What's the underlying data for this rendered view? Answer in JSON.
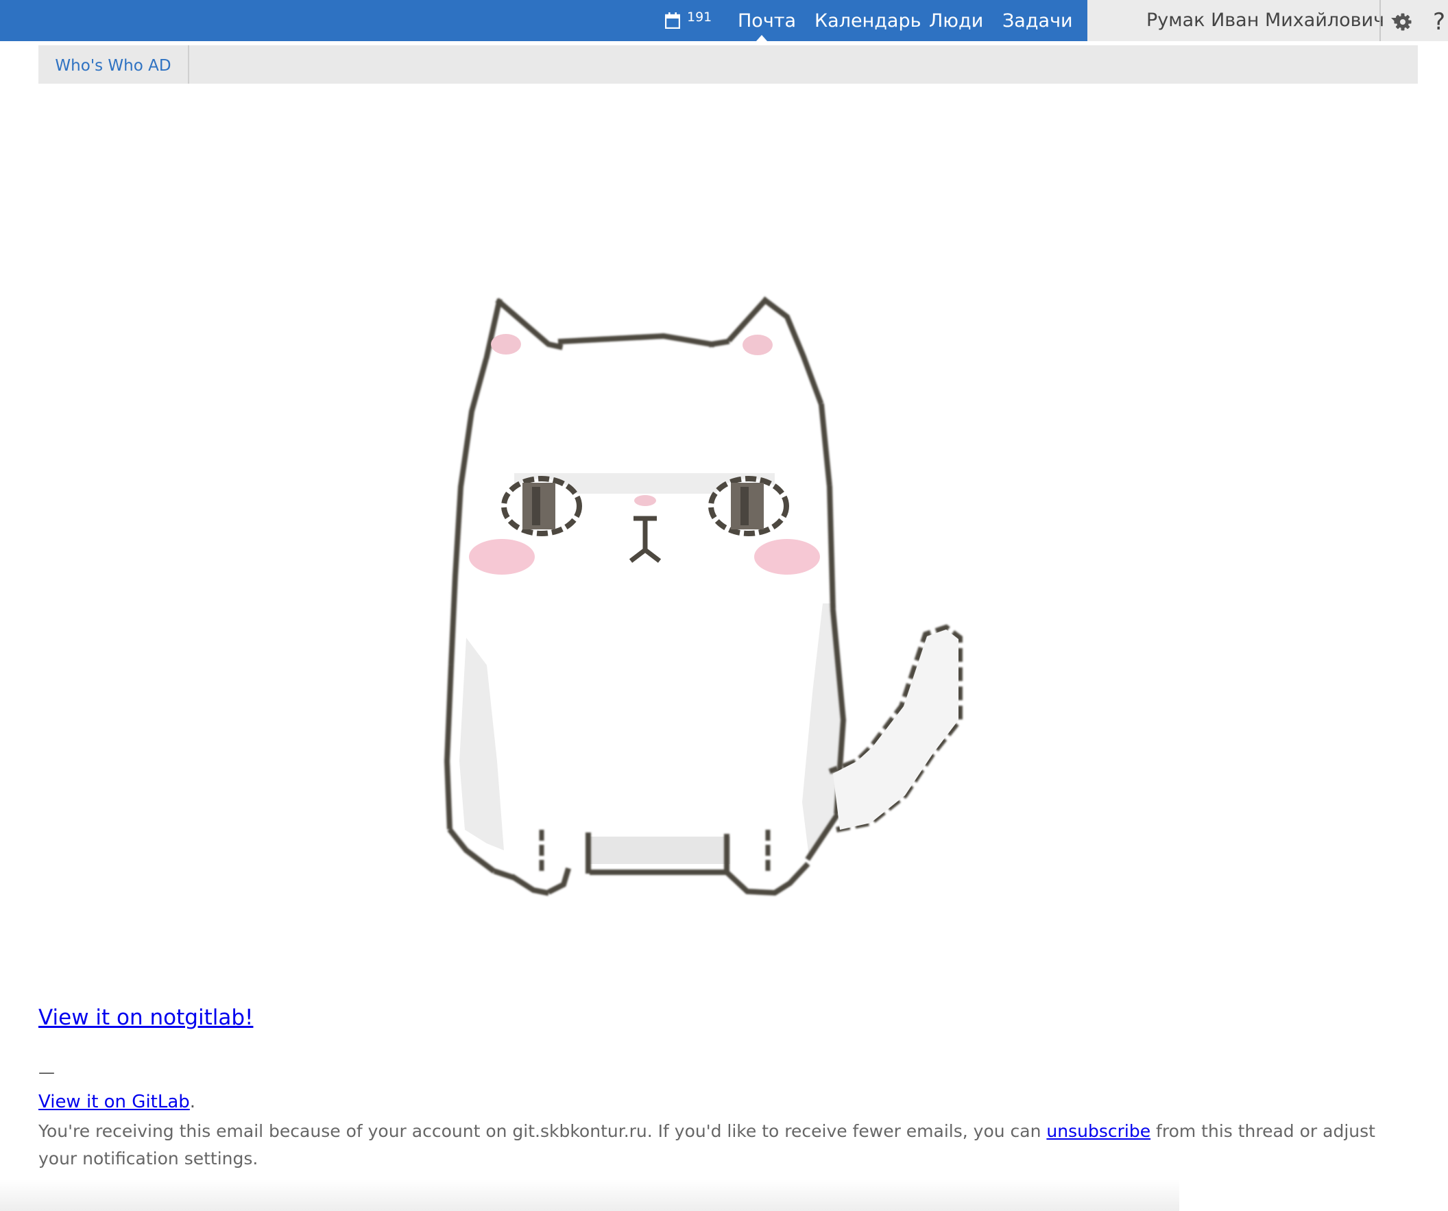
{
  "topbar": {
    "calendar_count": "191",
    "nav": {
      "mail": "Почта",
      "calendar": "Календарь",
      "people": "Люди",
      "tasks": "Задачи"
    },
    "user_name": "Румак Иван Михайлович",
    "help_label": "?"
  },
  "subbar": {
    "tab_label": "Who's Who AD"
  },
  "message": {
    "view_link": "View it on notgitlab!",
    "dash": "—",
    "gitlab_link": "View it on GitLab",
    "gitlab_suffix": ".",
    "footer_before": "You're receiving this email because of your account on git.skbkontur.ru. If you'd like to receive fewer emails, you can ",
    "unsubscribe_link": "unsubscribe",
    "footer_after": " from this thread or adjust your notification settings."
  },
  "colors": {
    "brand_blue": "#2e72c2",
    "link_blue": "#0000ee",
    "toolbar_grey": "#e9e9e9"
  },
  "icons": {
    "calendar": "calendar-icon",
    "gear": "gear-icon",
    "dropdown": "chevron-down-icon"
  }
}
